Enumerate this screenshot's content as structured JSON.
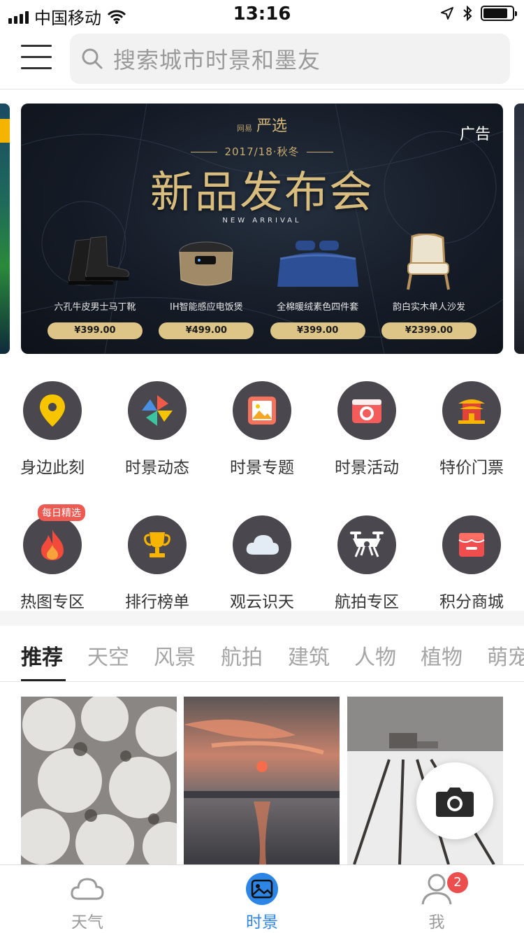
{
  "status_bar": {
    "carrier": "中国移动",
    "time": "13:16",
    "battery_level": 0.85
  },
  "header": {
    "search_placeholder": "搜索城市时景和墨友"
  },
  "banner": {
    "ad_label": "广告",
    "brand_small": "网易",
    "brand": "严选",
    "season": "2017/18·秋冬",
    "headline": "新品发布会",
    "subline": "NEW ARRIVAL",
    "products": [
      {
        "name": "六孔牛皮男士马丁靴",
        "price": "¥399.00",
        "icon": "boots-icon"
      },
      {
        "name": "IH智能感应电饭煲",
        "price": "¥499.00",
        "icon": "rice-cooker-icon"
      },
      {
        "name": "全棉暖绒素色四件套",
        "price": "¥399.00",
        "icon": "bedding-icon"
      },
      {
        "name": "韵白实木单人沙发",
        "price": "¥2399.00",
        "icon": "armchair-icon"
      }
    ]
  },
  "grid": {
    "row1": [
      {
        "label": "身边此刻",
        "icon": "location-pin-icon"
      },
      {
        "label": "时景动态",
        "icon": "pinwheel-icon"
      },
      {
        "label": "时景专题",
        "icon": "picture-icon"
      },
      {
        "label": "时景活动",
        "icon": "camera-icon"
      },
      {
        "label": "特价门票",
        "icon": "temple-icon"
      }
    ],
    "row2": [
      {
        "label": "热图专区",
        "icon": "flame-icon",
        "badge": "每日精选"
      },
      {
        "label": "排行榜单",
        "icon": "trophy-icon"
      },
      {
        "label": "观云识天",
        "icon": "cloud-icon"
      },
      {
        "label": "航拍专区",
        "icon": "drone-icon"
      },
      {
        "label": "积分商城",
        "icon": "shop-icon"
      }
    ]
  },
  "tabs": [
    "推荐",
    "天空",
    "风景",
    "航拍",
    "建筑",
    "人物",
    "植物",
    "萌宠"
  ],
  "active_tab": "推荐",
  "tabbar": {
    "items": [
      {
        "label": "天气",
        "icon": "cloud-outline-icon"
      },
      {
        "label": "时景",
        "icon": "gallery-icon"
      },
      {
        "label": "我",
        "icon": "user-icon"
      }
    ],
    "active": "时景",
    "me_badge": "2"
  },
  "colors": {
    "accent": "#2d86e6",
    "icon_circle": "#4b474e",
    "badge": "#ec5a51",
    "gold": "#d9bd7e"
  }
}
